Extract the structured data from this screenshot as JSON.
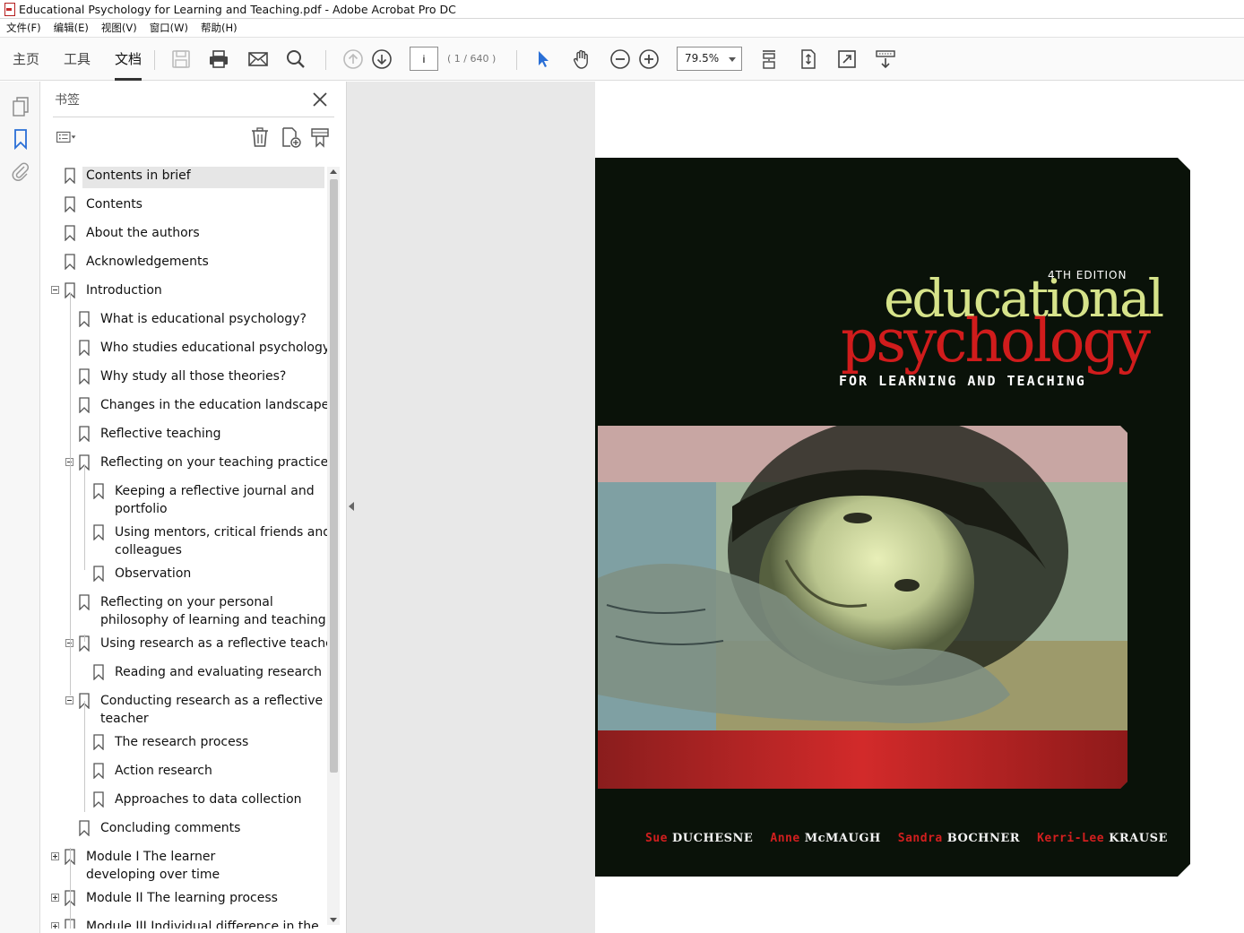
{
  "window": {
    "title": "Educational Psychology for Learning and Teaching.pdf - Adobe Acrobat Pro DC"
  },
  "menu": [
    "文件(F)",
    "编辑(E)",
    "视图(V)",
    "窗口(W)",
    "帮助(H)"
  ],
  "tabs": [
    {
      "label": "主页",
      "active": false
    },
    {
      "label": "工具",
      "active": false
    },
    {
      "label": "文档",
      "active": true
    }
  ],
  "toolbar": {
    "page_value": "i",
    "page_count": "( 1 / 640 )",
    "zoom_value": "79.5%",
    "icons": [
      "save-icon",
      "print-icon",
      "email-icon",
      "search-icon",
      "prev-page-icon",
      "next-page-icon",
      "select-cursor-icon",
      "hand-icon",
      "zoom-out-icon",
      "zoom-in-icon",
      "scroll-mode-icon",
      "fit-page-icon",
      "fullscreen-icon",
      "read-mode-icon"
    ]
  },
  "rail": {
    "icons": [
      "pages-icon",
      "bookmark-icon",
      "attachment-icon"
    ]
  },
  "panel": {
    "title": "书签",
    "bookmarks": [
      {
        "label": "Contents in brief",
        "level": 0,
        "expander": "none",
        "selected": true
      },
      {
        "label": "Contents",
        "level": 0,
        "expander": "none"
      },
      {
        "label": "About the authors",
        "level": 0,
        "expander": "none"
      },
      {
        "label": "Acknowledgements",
        "level": 0,
        "expander": "none"
      },
      {
        "label": "Introduction",
        "level": 0,
        "expander": "minus"
      },
      {
        "label": "What is educational psychology?",
        "level": 1,
        "expander": "none"
      },
      {
        "label": "Who studies educational psychology?",
        "level": 1,
        "expander": "none"
      },
      {
        "label": "Why study all those theories?",
        "level": 1,
        "expander": "none"
      },
      {
        "label": "Changes in the education landscape",
        "level": 1,
        "expander": "none"
      },
      {
        "label": "Reflective teaching",
        "level": 1,
        "expander": "none"
      },
      {
        "label": "Reflecting on your teaching practice",
        "level": 1,
        "expander": "minus"
      },
      {
        "label": "Keeping a reflective journal and",
        "label2": "portfolio",
        "level": 2,
        "expander": "none"
      },
      {
        "label": "Using mentors, critical friends and",
        "label2": "colleagues",
        "level": 2,
        "expander": "none"
      },
      {
        "label": "Observation",
        "level": 2,
        "expander": "none"
      },
      {
        "label": "Reflecting on your personal",
        "label2": "philosophy of learning and teaching",
        "level": 1,
        "expander": "none"
      },
      {
        "label": "Using research as a reflective teacher",
        "level": 1,
        "expander": "minus"
      },
      {
        "label": "Reading and evaluating research",
        "level": 2,
        "expander": "none"
      },
      {
        "label": "Conducting research as a reflective",
        "label2": "teacher",
        "level": 1,
        "expander": "minus"
      },
      {
        "label": "The research process",
        "level": 2,
        "expander": "none"
      },
      {
        "label": "Action research",
        "level": 2,
        "expander": "none"
      },
      {
        "label": "Approaches to data collection",
        "level": 2,
        "expander": "none"
      },
      {
        "label": "Concluding comments",
        "level": 1,
        "expander": "none"
      },
      {
        "label": "Module I The learner",
        "label2": "developing over time",
        "level": 0,
        "expander": "plus"
      },
      {
        "label": "Module II The learning process",
        "level": 0,
        "expander": "plus"
      },
      {
        "label": "Module III Individual difference in the",
        "level": 0,
        "expander": "plus"
      }
    ]
  },
  "cover": {
    "edition": "4TH EDITION",
    "title_line1": "educational",
    "title_line2": "psychology",
    "subtitle": "FOR LEARNING AND TEACHING",
    "authors": [
      {
        "first": "Sue",
        "last": "DUCHESNE"
      },
      {
        "first": "Anne",
        "last": "McMAUGH"
      },
      {
        "first": "Sandra",
        "last": "BOCHNER"
      },
      {
        "first": "Kerri-Lee",
        "last": "KRAUSE"
      }
    ],
    "colors": {
      "background": "#0a1209",
      "title1": "#d6e38a",
      "title2": "#d01c1c",
      "author_first": "#d21f1f"
    }
  }
}
